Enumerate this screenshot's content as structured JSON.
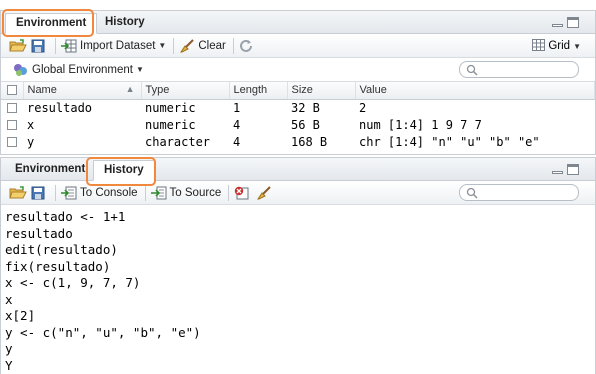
{
  "top_pane": {
    "tabs": [
      {
        "label": "Environment",
        "active": true
      },
      {
        "label": "History",
        "active": false
      }
    ],
    "toolbar": {
      "import_label": "Import Dataset",
      "clear_label": "Clear",
      "grid_label": "Grid"
    },
    "env_selector": "Global Environment",
    "search_placeholder": "",
    "columns": [
      "Name",
      "Type",
      "Length",
      "Size",
      "Value"
    ],
    "rows": [
      {
        "name": "resultado",
        "type": "numeric",
        "length": "1",
        "size": "32 B",
        "value": "2"
      },
      {
        "name": "x",
        "type": "numeric",
        "length": "4",
        "size": "56 B",
        "value": "num [1:4] 1 9 7 7"
      },
      {
        "name": "y",
        "type": "character",
        "length": "4",
        "size": "168 B",
        "value": "chr [1:4] \"n\" \"u\" \"b\" \"e\""
      }
    ]
  },
  "bottom_pane": {
    "tabs": [
      {
        "label": "Environment",
        "active": false
      },
      {
        "label": "History",
        "active": true
      }
    ],
    "toolbar": {
      "to_console_label": "To Console",
      "to_source_label": "To Source"
    },
    "search_placeholder": "",
    "history": [
      "resultado <- 1+1",
      "resultado",
      "edit(resultado)",
      "fix(resultado)",
      "x <- c(1, 9, 7, 7)",
      "x",
      "x[2]",
      "y <- c(\"n\", \"u\", \"b\", \"e\")",
      "y",
      "Y"
    ]
  },
  "colors": {
    "highlight": "#f0883e",
    "chrome_border": "#c9ced4"
  }
}
